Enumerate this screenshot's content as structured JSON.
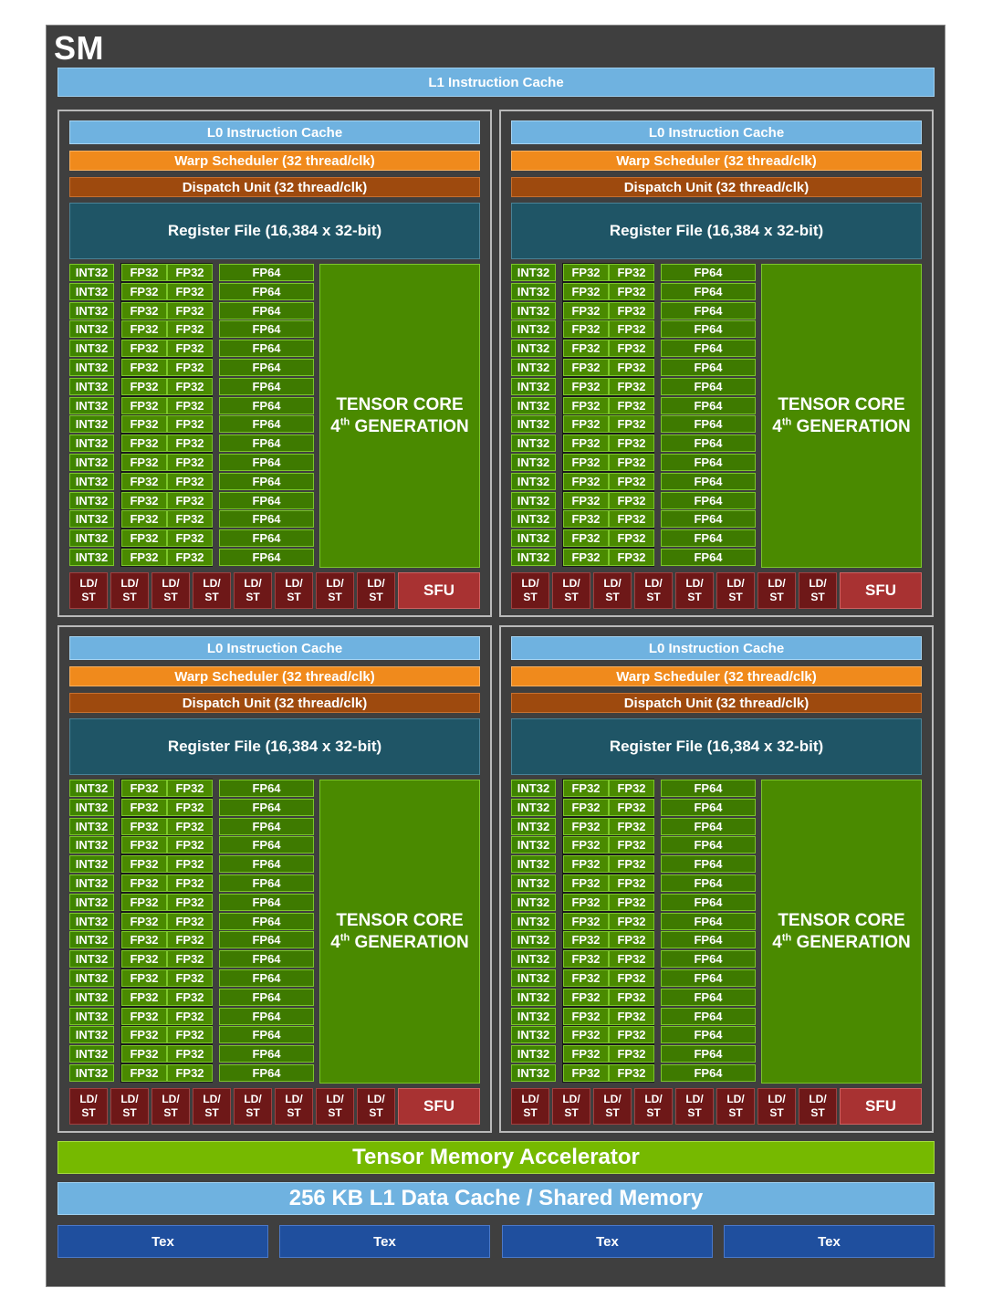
{
  "sm": {
    "title": "SM",
    "l1_instruction_cache": "L1 Instruction Cache",
    "tensor_memory_accelerator": "Tensor Memory Accelerator",
    "l1_data_cache": "256 KB L1 Data Cache / Shared Memory",
    "tex_units": [
      "Tex",
      "Tex",
      "Tex",
      "Tex"
    ]
  },
  "partition": {
    "l0_cache": "L0 Instruction Cache",
    "warp_scheduler": "Warp Scheduler (32 thread/clk)",
    "dispatch_unit": "Dispatch Unit (32 thread/clk)",
    "register_file": "Register File (16,384 x 32-bit)",
    "int32_label": "INT32",
    "fp32_label": "FP32",
    "fp64_label": "FP64",
    "rows": 16,
    "tensor_core_line1": "TENSOR CORE",
    "tensor_core_gen_num": "4",
    "tensor_core_gen_sup": "th",
    "tensor_core_gen_text": " GENERATION",
    "ldst_line1": "LD/",
    "ldst_line2": "ST",
    "ldst_count": 8,
    "sfu": "SFU"
  },
  "colors": {
    "background": "#3f3f3f",
    "cache_blue": "#6fb2e0",
    "warp_orange": "#f08a1c",
    "dispatch_brown": "#9e4a0e",
    "register_teal": "#1f5566",
    "core_green": "#4a8a00",
    "tma_green": "#76b900",
    "ldst_red": "#6e1818",
    "sfu_red": "#a83232",
    "tex_blue": "#1f4f9e"
  }
}
